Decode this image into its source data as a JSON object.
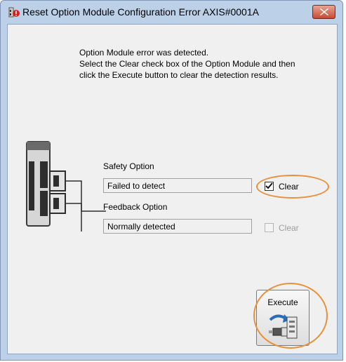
{
  "window": {
    "title": "Reset Option Module Configuration Error AXIS#0001A",
    "icons": {
      "app": "module-error-icon",
      "close": "close-icon"
    }
  },
  "message": {
    "line1": "Option Module error was detected.",
    "line2": "Select the Clear check box of the Option Module and then",
    "line3": "click the Execute button to clear the detection results."
  },
  "options": [
    {
      "label": "Safety Option",
      "status": "Failed to detect",
      "clear_label": "Clear",
      "clear_checked": true,
      "clear_enabled": true
    },
    {
      "label": "Feedback Option",
      "status": "Normally detected",
      "clear_label": "Clear",
      "clear_checked": false,
      "clear_enabled": false
    }
  ],
  "execute": {
    "label": "Execute",
    "icon": "execute-transfer-icon"
  },
  "colors": {
    "highlight": "#e8913a",
    "frame": "#bcd1e8",
    "close": "#c74b34"
  }
}
